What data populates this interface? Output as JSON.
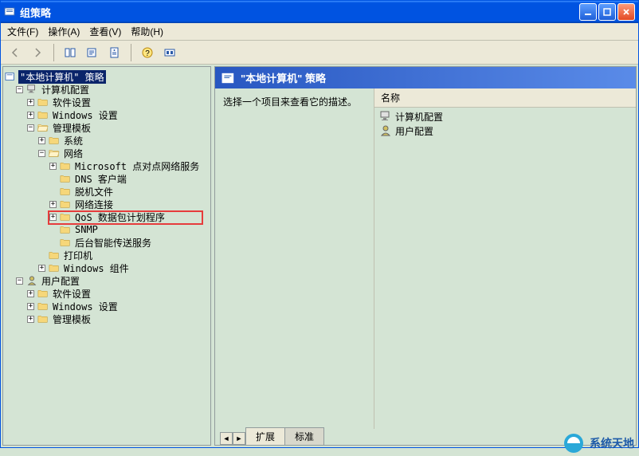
{
  "window": {
    "title": "组策略"
  },
  "menu": {
    "file": "文件(F)",
    "action": "操作(A)",
    "view": "查看(V)",
    "help": "帮助(H)"
  },
  "tree": {
    "root": "\"本地计算机\" 策略",
    "computer_config": "计算机配置",
    "software_settings": "软件设置",
    "windows_settings": "Windows 设置",
    "admin_templates": "管理模板",
    "system": "系统",
    "network": "网络",
    "ms_p2p": "Microsoft 点对点网络服务",
    "dns_client": "DNS 客户端",
    "offline_files": "脱机文件",
    "network_conn": "网络连接",
    "qos": "QoS 数据包计划程序",
    "snmp": "SNMP",
    "bits": "后台智能传送服务",
    "printers": "打印机",
    "windows_comp": "Windows 组件",
    "user_config": "用户配置",
    "u_software": "软件设置",
    "u_windows": "Windows 设置",
    "u_admin": "管理模板"
  },
  "right": {
    "header": "\"本地计算机\" 策略",
    "desc": "选择一个项目来查看它的描述。",
    "col_name": "名称",
    "item_computer": "计算机配置",
    "item_user": "用户配置",
    "tab_ext": "扩展",
    "tab_std": "标准"
  },
  "watermark": "系统天地"
}
